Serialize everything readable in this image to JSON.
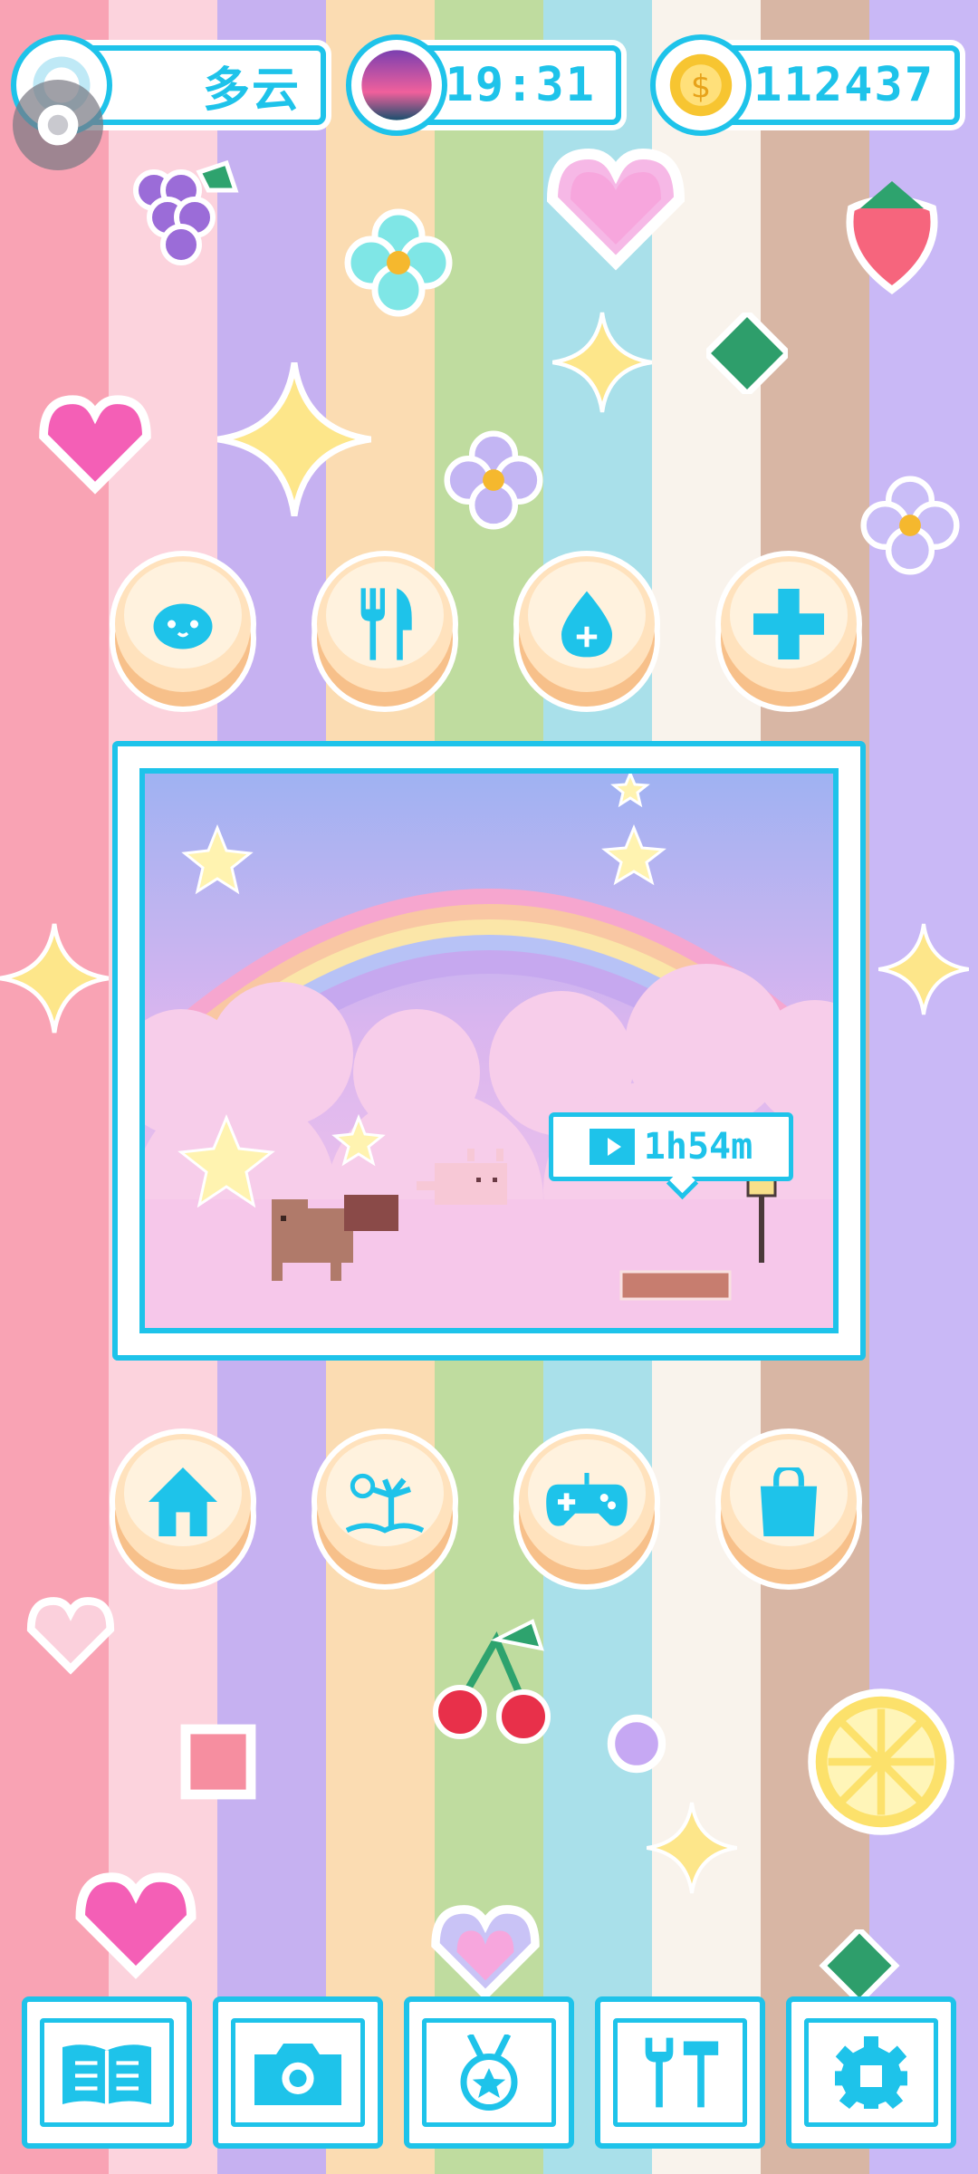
{
  "colors": {
    "accent": "#1ec3ea",
    "stripes": [
      "#f9a3b4",
      "#fcd3dd",
      "#c6b1f1",
      "#fbdcb2",
      "#bfdc9f",
      "#a9e0ea",
      "#f9f3ec",
      "#d8b6a4",
      "#c9b8f6"
    ]
  },
  "header": {
    "weather_icon": "cloud-icon",
    "weather_label": "多云",
    "time_icon": "sunset-icon",
    "time": "19:31",
    "coins_icon": "coin-icon",
    "coins": "112437"
  },
  "actions_top": [
    {
      "name": "pet-face-icon"
    },
    {
      "name": "food-fork-knife-icon"
    },
    {
      "name": "water-drop-icon"
    },
    {
      "name": "health-plus-icon"
    }
  ],
  "scene": {
    "timer_icon": "video-ad-icon",
    "timer_text": "1h54m"
  },
  "actions_bottom": [
    {
      "name": "home-icon"
    },
    {
      "name": "beach-island-icon"
    },
    {
      "name": "gamepad-icon"
    },
    {
      "name": "shop-bag-icon"
    }
  ],
  "nav": [
    {
      "name": "book-icon"
    },
    {
      "name": "camera-icon"
    },
    {
      "name": "medal-icon"
    },
    {
      "name": "tools-icon"
    },
    {
      "name": "settings-gear-icon"
    }
  ]
}
